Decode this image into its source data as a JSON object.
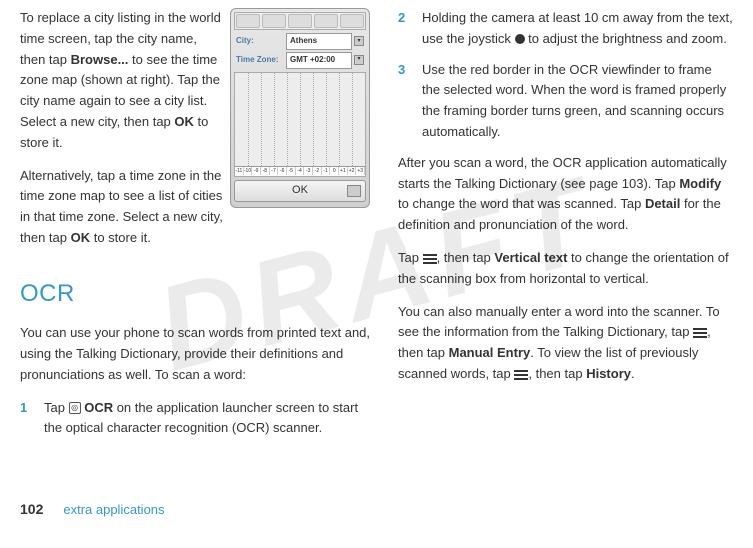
{
  "watermark": "DRAFT",
  "left": {
    "para1_pre": "To replace a city listing in the world time screen, tap the city name, then tap ",
    "browse": "Browse...",
    "para1_post": " to see the time zone map (shown at right). Tap the city name again to see a city list. Select a new city, then tap ",
    "ok1": "OK",
    "para1_end": " to store it.",
    "para2_pre": "Alternatively, tap a time zone in the time zone map to see a list of cities in that time zone. Select a new city, then tap ",
    "ok2": "OK",
    "para2_end": " to store it.",
    "ocr_heading": "OCR",
    "para3": "You can use your phone to scan words from printed text and, using the Talking Dictionary, provide their definitions and pronunciations as well. To scan a word:",
    "step1_num": "1",
    "step1_pre": "Tap ",
    "step1_bold": "OCR",
    "step1_post": " on the application launcher screen to start the optical character recognition (OCR) scanner."
  },
  "right": {
    "step2_num": "2",
    "step2_pre": "Holding the camera at least 10 cm away from the text, use the joystick ",
    "step2_post": " to adjust the brightness and zoom.",
    "step3_num": "3",
    "step3_text": "Use the red border in the OCR viewfinder to frame the selected word. When the word is framed properly the framing border turns green, and scanning occurs automatically.",
    "para4_pre": "After you scan a word, the OCR application automatically starts the Talking Dictionary (see page 103). Tap ",
    "modify": "Modify",
    "para4_mid": " to change the word that was scanned. Tap ",
    "detail": "Detail",
    "para4_end": " for the definition and pronunciation of the word.",
    "para5_pre": "Tap ",
    "para5_mid": ", then tap ",
    "vtext": "Vertical text",
    "para5_end": " to change the orientation of the scanning box from horizontal to vertical.",
    "para6_pre": " You can also manually enter a word into the scanner. To see the information from the Talking Dictionary, tap ",
    "para6_mid1": ", then tap ",
    "manual": "Manual Entry",
    "para6_mid2": ". To view the list of previously scanned words, tap ",
    "para6_mid3": ", then tap ",
    "history": "History",
    "para6_end": "."
  },
  "phone": {
    "city_label": "City:",
    "city_value": "Athens",
    "tz_label": "Time Zone:",
    "tz_value": "GMT +02:00",
    "ticks": [
      "-11",
      "-10",
      "-9",
      "-8",
      "-7",
      "-6",
      "-5",
      "-4",
      "-3",
      "-2",
      "-1",
      "0",
      "+1",
      "+2",
      "+3"
    ],
    "ok": "OK"
  },
  "footer": {
    "page": "102",
    "section": "extra applications"
  }
}
